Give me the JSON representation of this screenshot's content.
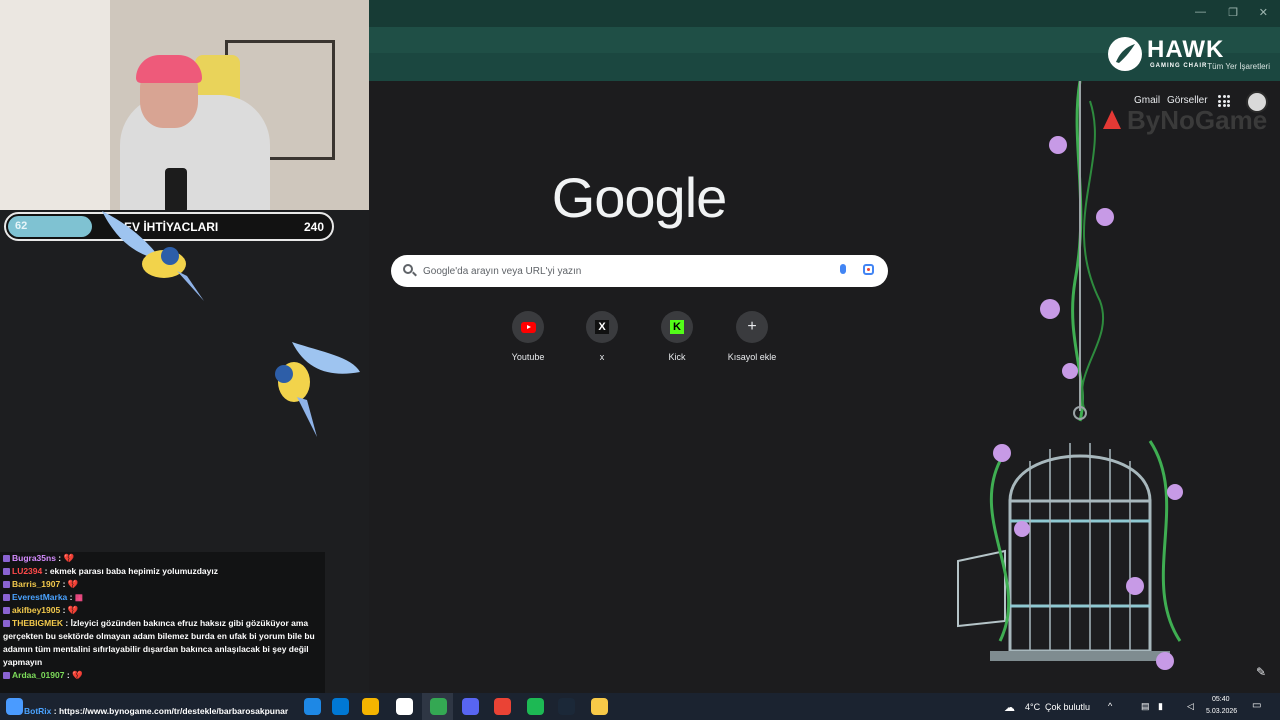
{
  "browser": {
    "window_controls": {
      "minimize": "—",
      "restore": "❐",
      "close": "✕"
    },
    "bookmarks_label": "Tüm Yer İşaretleri",
    "brand_overlay": {
      "hawk": "HAWK",
      "hawk_sub": "GAMING CHAIR",
      "bynogame": "ByNoGame"
    }
  },
  "google": {
    "logo": "Google",
    "top_links": {
      "gmail": "Gmail",
      "images": "Görseller"
    },
    "search_placeholder": "Google'da arayın veya URL'yi yazın",
    "shortcuts": [
      {
        "label": "Youtube",
        "icon": "youtube-icon"
      },
      {
        "label": "x",
        "icon": "x-icon",
        "glyph": "X"
      },
      {
        "label": "Kick",
        "icon": "kick-icon",
        "glyph": "K"
      },
      {
        "label": "Kısayol ekle",
        "icon": "plus-icon",
        "glyph": "+"
      }
    ],
    "edit_glyph": "✎"
  },
  "stream_overlay": {
    "goal": {
      "current": "62",
      "title": "EV İHTİYACLARI",
      "target": "240",
      "fill_fraction": 0.26
    },
    "chat": [
      {
        "user": "Bugra35ns",
        "sep": " :",
        "msg": "",
        "heart": " 💔",
        "color": "#d58cff"
      },
      {
        "user": "LU2394",
        "sep": " :",
        "msg": " ekmek parası baba hepimiz yolumuzdayız",
        "heart": "",
        "color": "#ff4a4a"
      },
      {
        "user": "Barris_1907",
        "sep": " :",
        "msg": "",
        "heart": " 💔",
        "color": "#f2c94c"
      },
      {
        "user": "EverestMarka",
        "sep": " :",
        "msg": "",
        "heart": " ▦",
        "color": "#4aa3ff"
      },
      {
        "user": "akifbey1905",
        "sep": " :",
        "msg": "",
        "heart": " 💔",
        "color": "#f2c94c"
      },
      {
        "user": "THEBIGMEK",
        "sep": " :",
        "msg": " İzleyici gözünden bakınca efruz haksız gibi gözüküyor ama gerçekten bu sektörde olmayan adam bilemez burda en ufak bi yorum bile bu adamın tüm mentalini sıfırlayabilir dışardan bakınca anlaşılacak bi şey değil yapmayın",
        "heart": "",
        "color": "#f2c94c"
      },
      {
        "user": "Ardaa_01907",
        "sep": " :",
        "msg": "",
        "heart": " 💔",
        "color": "#7ddc5a"
      }
    ],
    "bot_line": {
      "user": "BotRix",
      "msg": " : https://www.bynogame.com/tr/destekle/barbarosakpunar"
    }
  },
  "taskbar": {
    "weather_temp": "4°C",
    "weather_text": "Çok bulutlu",
    "time": "05:40",
    "date": "5.03.2026",
    "app_colors": [
      "#1e88e5",
      "#0078d4",
      "#f4b400",
      "#ffffff",
      "#34a853",
      "#5865f2",
      "#ea4335",
      "#1db954",
      "#1b2838",
      "#f7c948"
    ]
  }
}
